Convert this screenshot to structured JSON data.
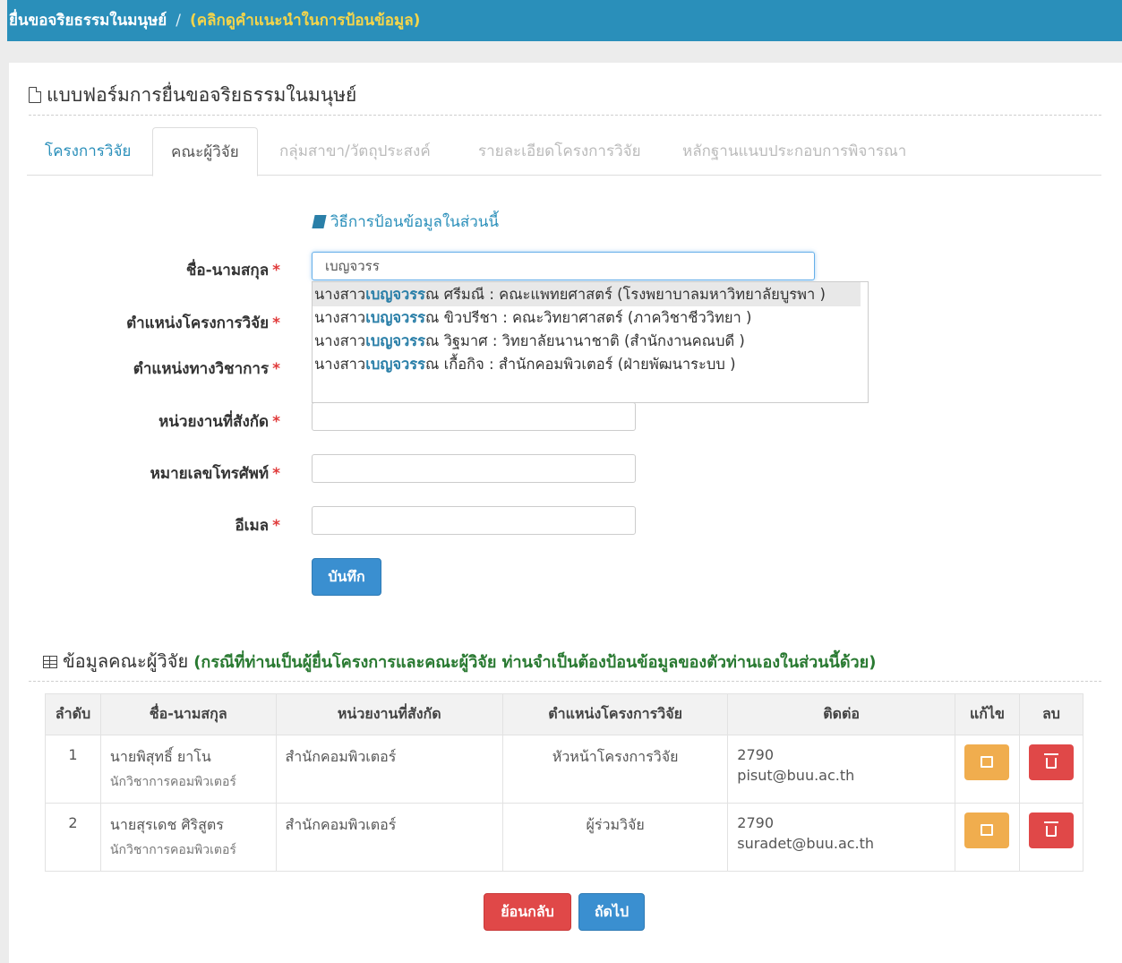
{
  "header": {
    "title": "ยื่นขอจริยธรรมในมนุษย์",
    "separator": "/",
    "hint": "(คลิกดูคำแนะนำในการป้อนข้อมูล)"
  },
  "form": {
    "title": "แบบฟอร์มการยื่นขอจริยธรรมในมนุษย์",
    "tabs": [
      "โครงการวิจัย",
      "คณะผู้วิจัย",
      "กลุ่มสาขา/วัตถุประสงค์",
      "รายละเอียดโครงการวิจัย",
      "หลักฐานแนบประกอบการพิจารณา"
    ],
    "howto": "วิธีการป้อนข้อมูลในส่วนนี้",
    "required_mark": "*",
    "fields": {
      "name": {
        "label": "ชื่อ-นามสกุล",
        "value": "เบญจวรร"
      },
      "project_position": {
        "label": "ตำแหน่งโครงการวิจัย"
      },
      "academic_position": {
        "label": "ตำแหน่งทางวิชาการ"
      },
      "unit": {
        "label": "หน่วยงานที่สังกัด",
        "value": ""
      },
      "phone": {
        "label": "หมายเลขโทรศัพท์",
        "value": ""
      },
      "email": {
        "label": "อีเมล",
        "value": ""
      }
    },
    "autocomplete": [
      {
        "pre": "นางสาว",
        "match": "เบญจวรร",
        "post": "ณ ศรีมณี : คณะแพทยศาสตร์ (โรงพยาบาลมหาวิทยาลัยบูรพา )"
      },
      {
        "pre": "นางสาว",
        "match": "เบญจวรร",
        "post": "ณ ขิวปรีชา : คณะวิทยาศาสตร์ (ภาควิชาชีววิทยา )"
      },
      {
        "pre": "นางสาว",
        "match": "เบญจวรร",
        "post": "ณ วิฐมาศ : วิทยาลัยนานาชาติ (สำนักงานคณบดี )"
      },
      {
        "pre": "นางสาว",
        "match": "เบญจวรร",
        "post": "ณ เกื้อกิจ : สำนักคอมพิวเตอร์ (ฝ่ายพัฒนาระบบ )"
      }
    ],
    "save_label": "บันทึก"
  },
  "team": {
    "title": "ข้อมูลคณะผู้วิจัย",
    "note": "(กรณีที่ท่านเป็นผู้ยื่นโครงการและคณะผู้วิจัย ท่านจำเป็นต้องป้อนข้อมูลของตัวท่านเองในส่วนนี้ด้วย)",
    "columns": [
      "ลำดับ",
      "ชื่อ-นามสกุล",
      "หน่วยงานที่สังกัด",
      "ตำแหน่งโครงการวิจัย",
      "ติดต่อ",
      "แก้ไข",
      "ลบ"
    ],
    "rows": [
      {
        "no": "1",
        "name": "นายพิสุทธิ์ ยาโน",
        "title": "นักวิชาการคอมพิวเตอร์",
        "unit": "สำนักคอมพิวเตอร์",
        "role": "หัวหน้าโครงการวิจัย",
        "phone": "2790",
        "email": "pisut@buu.ac.th"
      },
      {
        "no": "2",
        "name": "นายสุรเดช ศิริสูตร",
        "title": "นักวิชาการคอมพิวเตอร์",
        "unit": "สำนักคอมพิวเตอร์",
        "role": "ผู้ร่วมวิจัย",
        "phone": "2790",
        "email": "suradet@buu.ac.th"
      }
    ]
  },
  "nav": {
    "back_label": "ย้อนกลับ",
    "next_label": "ถัดไป"
  },
  "colors": {
    "header_bg": "#2a8fba",
    "hint": "#f5d54a",
    "primary": "#3a8fd0",
    "danger": "#e04848",
    "warning": "#f0ad4e",
    "note": "#2a7a32"
  }
}
